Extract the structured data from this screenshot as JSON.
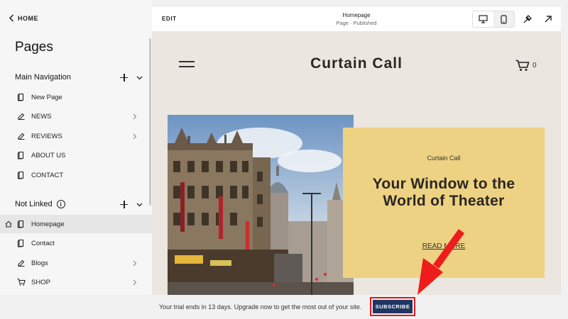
{
  "sidebar": {
    "home_label": "HOME",
    "title": "Pages",
    "main_nav": {
      "label": "Main Navigation",
      "items": [
        {
          "label": "New Page",
          "icon": "page-icon",
          "has_children": false
        },
        {
          "label": "NEWS",
          "icon": "blog-icon",
          "has_children": true
        },
        {
          "label": "REVIEWS",
          "icon": "blog-icon",
          "has_children": true
        },
        {
          "label": "ABOUT US",
          "icon": "page-icon",
          "has_children": false
        },
        {
          "label": "CONTACT",
          "icon": "page-icon",
          "has_children": false
        }
      ]
    },
    "not_linked": {
      "label": "Not Linked",
      "items": [
        {
          "label": "Homepage",
          "icon": "page-icon",
          "active": true,
          "is_home": true
        },
        {
          "label": "Contact",
          "icon": "page-icon",
          "has_children": false
        },
        {
          "label": "Blogs",
          "icon": "blog-icon",
          "has_children": true
        },
        {
          "label": "SHOP",
          "icon": "cart-icon",
          "has_children": true
        }
      ]
    }
  },
  "topbar": {
    "edit_label": "EDIT",
    "page_title": "Homepage",
    "page_status": "Page · Published"
  },
  "site": {
    "title": "Curtain Call",
    "cart_count": "0",
    "card": {
      "eyebrow": "Curtain Call",
      "headline": "Your Window to the World of Theater",
      "cta": "READ MORE"
    }
  },
  "trial": {
    "message": "Your trial ends in 13 days. Upgrade now to get the most out of your site.",
    "subscribe_label": "SUBSCRIBE"
  },
  "colors": {
    "preview_bg": "#ebe6df",
    "card_bg": "#edd283",
    "subscribe_bg": "#1f3563",
    "highlight": "#e0191e"
  }
}
